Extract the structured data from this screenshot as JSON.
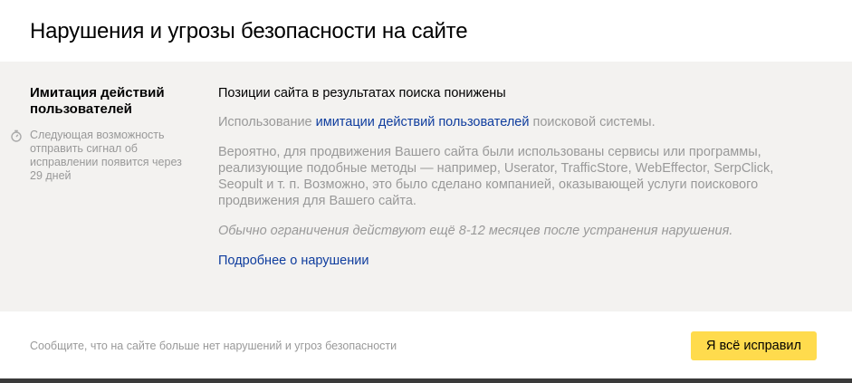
{
  "header": {
    "title": "Нарушения и угрозы безопасности на сайте"
  },
  "sidebar": {
    "title": "Имитация действий пользователей",
    "note_icon": "stopwatch-icon",
    "note": "Следующая возможность отправить сигнал об исправлении появится через 29 дней"
  },
  "content": {
    "title": "Позиции сайта в результатах поиска понижены",
    "p1_before": "Использование ",
    "p1_link": "имитации действий пользователей",
    "p1_after": " поисковой системы.",
    "p2": "Вероятно, для продвижения Вашего сайта были использованы сервисы или программы, реализующие подобные методы — например, Userator, TrafficStore, WebEffector, SerpClick, Seopult и т. п. Возможно, это было сделано компанией, оказывающей услуги поискового продвижения для Вашего сайта.",
    "p3": "Обычно ограничения действуют ещё 8-12 месяцев после устранения нарушения.",
    "more_link": "Подробнее о нарушении"
  },
  "footer": {
    "text": "Сообщите, что на сайте больше нет нарушений и угроз безопасности",
    "button_label": "Я всё исправил"
  },
  "colors": {
    "main_bg": "#f3f2f0",
    "link": "#0f3d9e",
    "muted_text": "#999999",
    "button_bg": "#ffdb4d",
    "bottom_bar": "#3a3a3a"
  }
}
